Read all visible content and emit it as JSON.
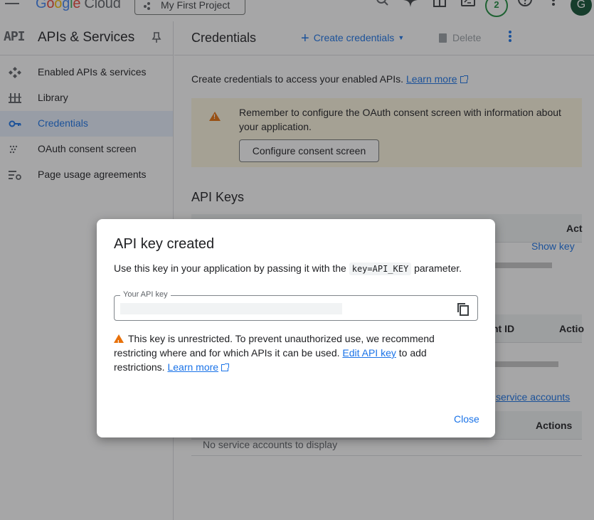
{
  "topbar": {
    "logo_letters": [
      "G",
      "o",
      "o",
      "g",
      "l",
      "e"
    ],
    "logo_product": "Cloud",
    "project_name": "My First Project",
    "notification_count": "2",
    "avatar_initial": "G",
    "icons": [
      "menu-icon",
      "search-icon",
      "gemini-icon",
      "gift-icon",
      "cloud-shell-icon",
      "help-icon",
      "more-vert-icon"
    ]
  },
  "sidenav": {
    "mark": "API",
    "title": "APIs & Services",
    "items": [
      {
        "label": "Enabled APIs & services",
        "icon": "enabled-apis-icon",
        "active": false
      },
      {
        "label": "Library",
        "icon": "library-icon",
        "active": false
      },
      {
        "label": "Credentials",
        "icon": "key-icon",
        "active": true
      },
      {
        "label": "OAuth consent screen",
        "icon": "consent-icon",
        "active": false
      },
      {
        "label": "Page usage agreements",
        "icon": "agreements-icon",
        "active": false
      }
    ]
  },
  "main": {
    "title": "Credentials",
    "create_label": "Create credentials",
    "delete_label": "Delete",
    "intro_text": "Create credentials to access your enabled APIs.",
    "learn_more": "Learn more",
    "warning_text": "Remember to configure the OAuth consent screen with information about your application.",
    "configure_button": "Configure consent screen",
    "api_keys_title": "API Keys",
    "api_keys_actions_header": "Act",
    "show_key": "Show key",
    "oauth_header_id": "nt ID",
    "oauth_header_actions": "Actio",
    "manage_service_accounts": "service accounts",
    "service_accounts_actions_header": "Actions",
    "no_service_accounts": "No service accounts to display"
  },
  "dialog": {
    "title": "API key created",
    "desc_before": "Use this key in your application by passing it with the",
    "desc_code": "key=API_KEY",
    "desc_after": "parameter.",
    "field_label": "Your API key",
    "warning_before": "This key is unrestricted. To prevent unauthorized use, we recommend restricting where and for which APIs it can be used.",
    "edit_link": "Edit API key",
    "warning_after": "to add restrictions.",
    "learn_more": "Learn more",
    "close_label": "Close"
  },
  "colors": {
    "accent": "#1a73e8",
    "warning": "#e8710a",
    "warning_bg": "#fef7e0",
    "active_nav_bg": "#e8f0fe",
    "status_green": "#1e8e3e"
  }
}
